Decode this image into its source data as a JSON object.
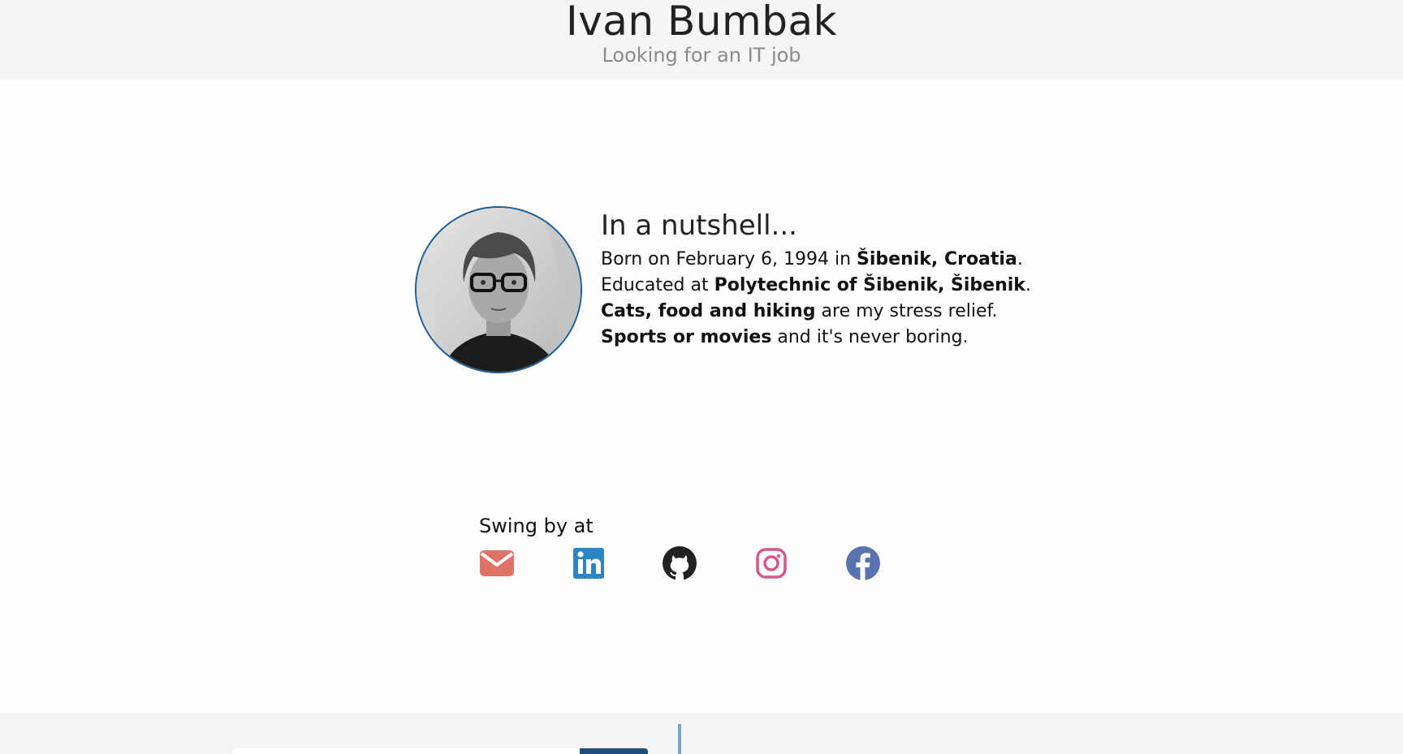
{
  "header": {
    "name": "Ivan Bumbak",
    "tagline": "Looking for an IT job"
  },
  "bio": {
    "heading": "In a nutshell...",
    "line1": {
      "prefix": "Born on February 6, 1994 in ",
      "bold": "Šibenik, Croatia",
      "suffix": "."
    },
    "line2": {
      "prefix": "Educated at ",
      "bold": "Polytechnic of Šibenik, Šibenik",
      "suffix": "."
    },
    "line3": {
      "bold": "Cats, food and hiking",
      "suffix": " are my stress relief."
    },
    "line4": {
      "bold": "Sports or movies",
      "suffix": " and it's never boring."
    }
  },
  "social": {
    "title": "Swing by at",
    "icons": [
      {
        "name": "email-icon",
        "color": "#e07368"
      },
      {
        "name": "linkedin-icon",
        "color": "#2b86c5"
      },
      {
        "name": "github-icon",
        "color": "#222222"
      },
      {
        "name": "instagram-icon",
        "color": "#d9538d"
      },
      {
        "name": "facebook-icon",
        "color": "#5b73b0"
      }
    ]
  },
  "colors": {
    "header_bg": "#f5f5f5",
    "avatar_border": "#1f5d94",
    "footer_bg": "#f4f4f4",
    "footer_button": "#1f4e79"
  }
}
